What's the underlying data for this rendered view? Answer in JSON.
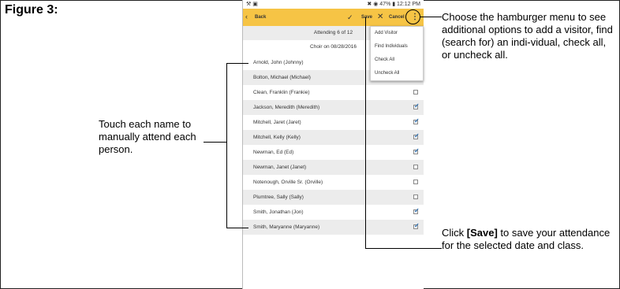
{
  "figure_label": "Figure 3:",
  "status": {
    "left": "⚒ ▣",
    "right": "✖ ◉ 47% ▮ 12:12 PM"
  },
  "appbar": {
    "back_icon": "‹",
    "back": "Back",
    "save_icon": "✓",
    "save": "Save",
    "cancel_icon": "✕",
    "cancel": "Cancel",
    "menu_icon": "⋮"
  },
  "header": {
    "attending": "Attending 6 of 12",
    "class_info": "Choir on 08/28/2016"
  },
  "people": [
    {
      "name": "Arnold, John (Johnny)",
      "checked": null
    },
    {
      "name": "Bolton, Michael (Michael)",
      "checked": null
    },
    {
      "name": "Clean, Franklin (Frankie)",
      "checked": false
    },
    {
      "name": "Jackson, Meredith (Meredith)",
      "checked": true
    },
    {
      "name": "Mitchell, Jaret (Jaret)",
      "checked": true
    },
    {
      "name": "Mitchell, Kelly (Kelly)",
      "checked": true
    },
    {
      "name": "Newman, Ed (Ed)",
      "checked": true
    },
    {
      "name": "Newman, Janet (Janet)",
      "checked": false
    },
    {
      "name": "Notenough, Orville Sr. (Orville)",
      "checked": false
    },
    {
      "name": "Plumtree, Sally (Sally)",
      "checked": false
    },
    {
      "name": "Smith, Jonathan (Jon)",
      "checked": true
    },
    {
      "name": "Smith, Maryanne (Maryanne)",
      "checked": true
    }
  ],
  "menu": {
    "items": [
      "Add Visitor",
      "Find Individuals",
      "Check All",
      "Uncheck All"
    ]
  },
  "annotations": {
    "menu_note": "Choose the hamburger menu to see additional options to add a visitor, find (search for) an indi-vidual, check all, or uncheck all.",
    "names_note": "Touch each name to manually attend each person.",
    "save_note_prefix": "Click ",
    "save_note_bold": "[Save]",
    "save_note_suffix": " to save your attendance for the selected date and class."
  },
  "colors": {
    "appbar": "#f6c445",
    "check": "#2b6fb3"
  }
}
